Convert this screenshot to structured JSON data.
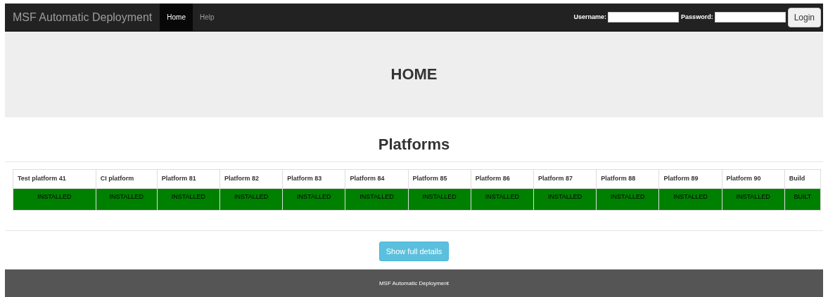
{
  "navbar": {
    "brand": "MSF Automatic Deployment",
    "links": [
      {
        "label": "Home",
        "selected": true
      },
      {
        "label": "Help",
        "selected": false
      }
    ],
    "login": {
      "username_label": "Username:",
      "password_label": "Password:",
      "button": "Login"
    }
  },
  "header": {
    "title": "HOME"
  },
  "platforms": {
    "title": "Platforms",
    "columns": [
      {
        "name": "Test platform 41",
        "status": "INSTALLED",
        "color": "#008000"
      },
      {
        "name": "CI platform",
        "status": "INSTALLED",
        "color": "#008000"
      },
      {
        "name": "Platform 81",
        "status": "INSTALLED",
        "color": "#008000"
      },
      {
        "name": "Platform 82",
        "status": "INSTALLED",
        "color": "#008000"
      },
      {
        "name": "Platform 83",
        "status": "INSTALLED",
        "color": "#008000"
      },
      {
        "name": "Platform 84",
        "status": "INSTALLED",
        "color": "#008000"
      },
      {
        "name": "Platform 85",
        "status": "INSTALLED",
        "color": "#008000"
      },
      {
        "name": "Platform 86",
        "status": "INSTALLED",
        "color": "#008000"
      },
      {
        "name": "Platform 87",
        "status": "INSTALLED",
        "color": "#008000"
      },
      {
        "name": "Platform 88",
        "status": "INSTALLED",
        "color": "#008000"
      },
      {
        "name": "Platform 89",
        "status": "INSTALLED",
        "color": "#008000"
      },
      {
        "name": "Platform 90",
        "status": "INSTALLED",
        "color": "#008000"
      },
      {
        "name": "Build",
        "status": "BUILT",
        "color": "#008000"
      }
    ],
    "details_button": "Show full details"
  },
  "footer": {
    "text": "MSF Automatic Deployment"
  }
}
